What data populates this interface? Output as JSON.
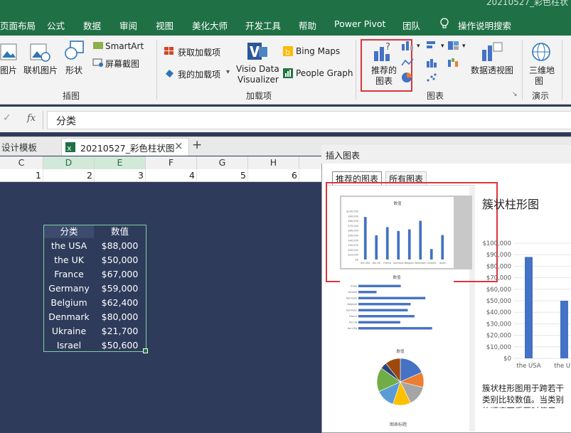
{
  "window": {
    "title": "20210527_彩色柱状"
  },
  "menu": [
    "页面布局",
    "公式",
    "数据",
    "审阅",
    "视图",
    "美化大师",
    "开发工具",
    "帮助",
    "Power Pivot",
    "团队"
  ],
  "tell_me": "操作说明搜索",
  "ribbon": {
    "pictures": "图片",
    "online_pictures": "联机图片",
    "shapes": "形状",
    "smartart": "SmartArt",
    "screenshot": "屏幕截图",
    "group_illustrations": "插图",
    "get_addins": "获取加载项",
    "my_addins": "我的加载项",
    "visio_line1": "Visio Data",
    "visio_line2": "Visualizer",
    "bing_maps": "Bing Maps",
    "people_graph": "People Graph",
    "group_addins": "加载项",
    "recommended_line1": "推荐的",
    "recommended_line2": "图表",
    "pivot_chart": "数据透视图",
    "group_charts": "图表",
    "map3d_line1": "三维地",
    "map3d_line2": "图",
    "group_tours": "演示"
  },
  "formula_bar": {
    "fx": "fx",
    "value": "分类"
  },
  "sheet_tabs": {
    "prev_tab": "设计模板",
    "file_tab": "20210527_彩色柱状图",
    "add": "+"
  },
  "columns": [
    "C",
    "D",
    "E",
    "F",
    "G",
    "H"
  ],
  "row_numbers": [
    "1",
    "2",
    "3",
    "4",
    "5",
    "6"
  ],
  "table": {
    "headers": [
      "分类",
      "数值"
    ],
    "rows": [
      [
        "the USA",
        "$88,000"
      ],
      [
        "the UK",
        "$50,000"
      ],
      [
        "France",
        "$67,000"
      ],
      [
        "Germany",
        "$59,000"
      ],
      [
        "Belgium",
        "$62,400"
      ],
      [
        "Denmark",
        "$80,000"
      ],
      [
        "Ukraine",
        "$21,700"
      ],
      [
        "Israel",
        "$50,600"
      ]
    ]
  },
  "dialog": {
    "title": "插入图表",
    "tab_recommended": "推荐的图表",
    "tab_all": "所有图表",
    "preview_title": "簇状柱形图",
    "description": "簇状柱形图用于跨若干类别比较数值。当类别的顺序不重要时使用它。",
    "thumb_title": "数值",
    "thumb3_title": "图表标题"
  },
  "chart_data": {
    "type": "bar",
    "categories": [
      "the USA",
      "the UK",
      "France",
      "Germany",
      "Belgium",
      "Denmark",
      "Ukraine",
      "Israel"
    ],
    "values": [
      88000,
      50000,
      67000,
      59000,
      62400,
      80000,
      21700,
      50600
    ],
    "title": "数值",
    "ylim": [
      0,
      100000
    ],
    "yticks": [
      "$100,000",
      "$90,000",
      "$80,000",
      "$70,000",
      "$60,000",
      "$50,000",
      "$40,000",
      "$30,000",
      "$20,000",
      "$10,000",
      "$0"
    ],
    "colors": {
      "bar": "#4472c4",
      "pie": [
        "#4472c4",
        "#ed7d31",
        "#a5a5a5",
        "#ffc000",
        "#5b9bd5",
        "#70ad47",
        "#264478",
        "#9e480e"
      ]
    }
  },
  "colors": {
    "excel_green": "#1f7145",
    "sheet_bg": "#2f3b5a",
    "highlight": "#d9363e"
  }
}
